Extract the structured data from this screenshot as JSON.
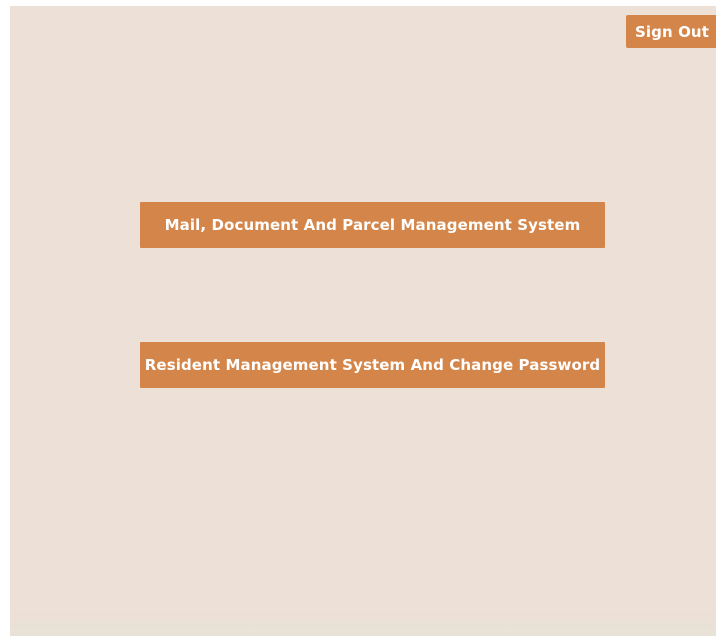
{
  "header": {
    "sign_out_label": "Sign Out"
  },
  "main": {
    "buttons": [
      {
        "label": "Mail, Document And Parcel Management System"
      },
      {
        "label": "Resident Management System And Change Password"
      }
    ]
  },
  "colors": {
    "background": "#ede0d6",
    "accent": "#d4854a",
    "button_text": "#ffffff"
  }
}
